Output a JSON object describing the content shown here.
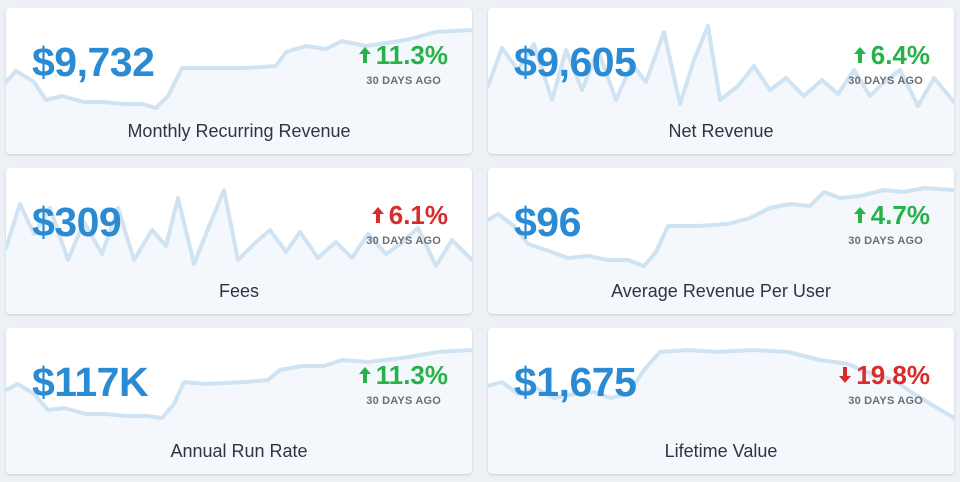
{
  "metrics": [
    {
      "name": "mrr",
      "value": "$9,732",
      "change": "11.3%",
      "direction": "up",
      "period": "30 DAYS AGO",
      "label": "Monthly Recurring Revenue"
    },
    {
      "name": "net-revenue",
      "value": "$9,605",
      "change": "6.4%",
      "direction": "up",
      "period": "30 DAYS AGO",
      "label": "Net Revenue"
    },
    {
      "name": "fees",
      "value": "$309",
      "change": "6.1%",
      "direction": "up",
      "period": "30 DAYS AGO",
      "label": "Fees"
    },
    {
      "name": "arpu",
      "value": "$96",
      "change": "4.7%",
      "direction": "up",
      "period": "30 DAYS AGO",
      "label": "Average Revenue Per User"
    },
    {
      "name": "arr",
      "value": "$117K",
      "change": "11.3%",
      "direction": "up",
      "period": "30 DAYS AGO",
      "label": "Annual Run Rate"
    },
    {
      "name": "ltv",
      "value": "$1,675",
      "change": "19.8%",
      "direction": "down",
      "period": "30 DAYS AGO",
      "label": "Lifetime Value"
    }
  ],
  "colors": {
    "value": "#2a8ad4",
    "up": "#27b149",
    "down": "#d92b2b",
    "sparkline": "#cfe3f3",
    "background": "#edf1f5"
  },
  "icons": {
    "up": "arrow-up-icon",
    "down": "arrow-down-icon"
  }
}
